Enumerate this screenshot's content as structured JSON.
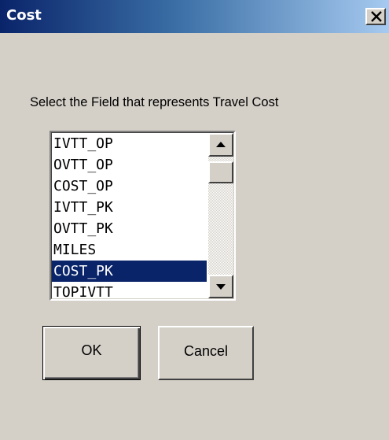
{
  "window": {
    "title": "Cost",
    "close_glyph": "✕"
  },
  "prompt": "Select the Field that represents Travel Cost",
  "listbox": {
    "items": [
      "IVTT_OP",
      "OVTT_OP",
      "COST_OP",
      "IVTT_PK",
      "OVTT_PK",
      "MILES",
      "COST_PK",
      "TOPIVTT"
    ],
    "selected": "COST_PK"
  },
  "buttons": {
    "ok": "OK",
    "cancel": "Cancel"
  },
  "colors": {
    "selection": "#0a246a",
    "face": "#d4d0c8",
    "title_start": "#0a246a",
    "title_end": "#a6caf0"
  }
}
